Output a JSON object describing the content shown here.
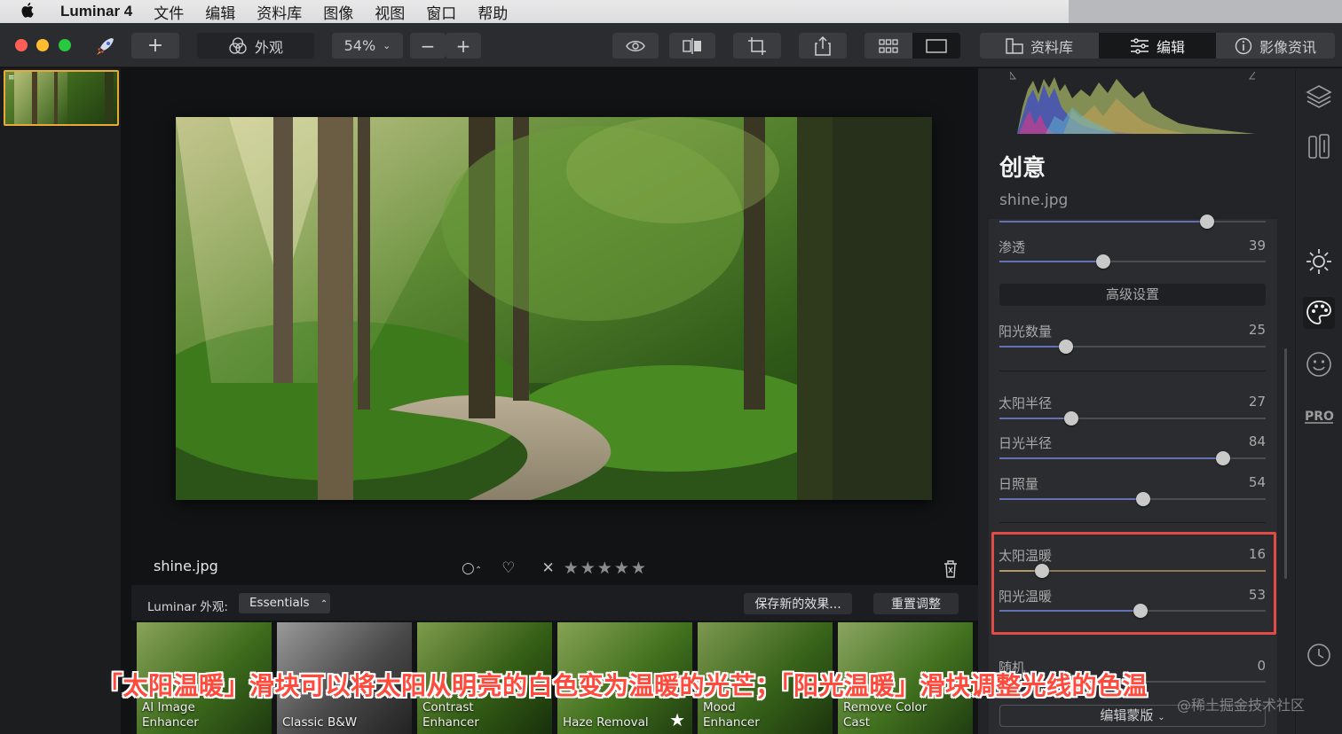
{
  "menubar": {
    "app_name": "Luminar 4",
    "items": [
      "文件",
      "编辑",
      "资料库",
      "图像",
      "视图",
      "窗口",
      "帮助"
    ]
  },
  "toolbar": {
    "add_label": "+",
    "looks_label": "外观",
    "zoom": "54%",
    "zoom_out": "−",
    "zoom_in": "+",
    "tabs": {
      "library": "资料库",
      "edit": "编辑",
      "info": "影像资讯"
    }
  },
  "workspace": {
    "filename": "shine.jpg",
    "stars": "★★★★★",
    "reject": "✕"
  },
  "looksbar": {
    "label": "Luminar 外观:",
    "selected": "Essentials",
    "save_btn": "保存新的效果...",
    "reset_btn": "重置调整"
  },
  "looks": [
    {
      "line1": "AI Image",
      "line2": "Enhancer"
    },
    {
      "line1": "",
      "line2": "Classic B&W"
    },
    {
      "line1": "Contrast",
      "line2": "Enhancer"
    },
    {
      "line1": "",
      "line2": "Haze Removal"
    },
    {
      "line1": "Mood",
      "line2": "Enhancer"
    },
    {
      "line1": "Remove Color",
      "line2": "Cast"
    }
  ],
  "panel": {
    "title": "创意",
    "file": "shine.jpg",
    "advanced": "高级设置",
    "mask_btn": "编辑蒙版",
    "controls": {
      "penetration": {
        "label": "渗透",
        "value": 39
      },
      "sun_rays_count": {
        "label": "阳光数量",
        "value": 25
      },
      "sun_radius": {
        "label": "太阳半径",
        "value": 27
      },
      "ray_radius": {
        "label": "日光半径",
        "value": 84
      },
      "exposure": {
        "label": "日照量",
        "value": 54
      },
      "sun_warmth": {
        "label": "太阳温暖",
        "value": 16
      },
      "ray_warmth": {
        "label": "阳光温暖",
        "value": 53
      },
      "random": {
        "label": "随机",
        "value": 0
      }
    }
  },
  "caption": "「太阳温暖」滑块可以将太阳从明亮的白色变为温暖的光芒；「阳光温暖」滑块调整光线的色温",
  "watermark": "@稀土掘金技术社区",
  "colors": {
    "accent": "#6470b4",
    "highlight": "#e04b45",
    "caption": "#ff4a3c",
    "selected_thumb": "#e7a93a"
  }
}
